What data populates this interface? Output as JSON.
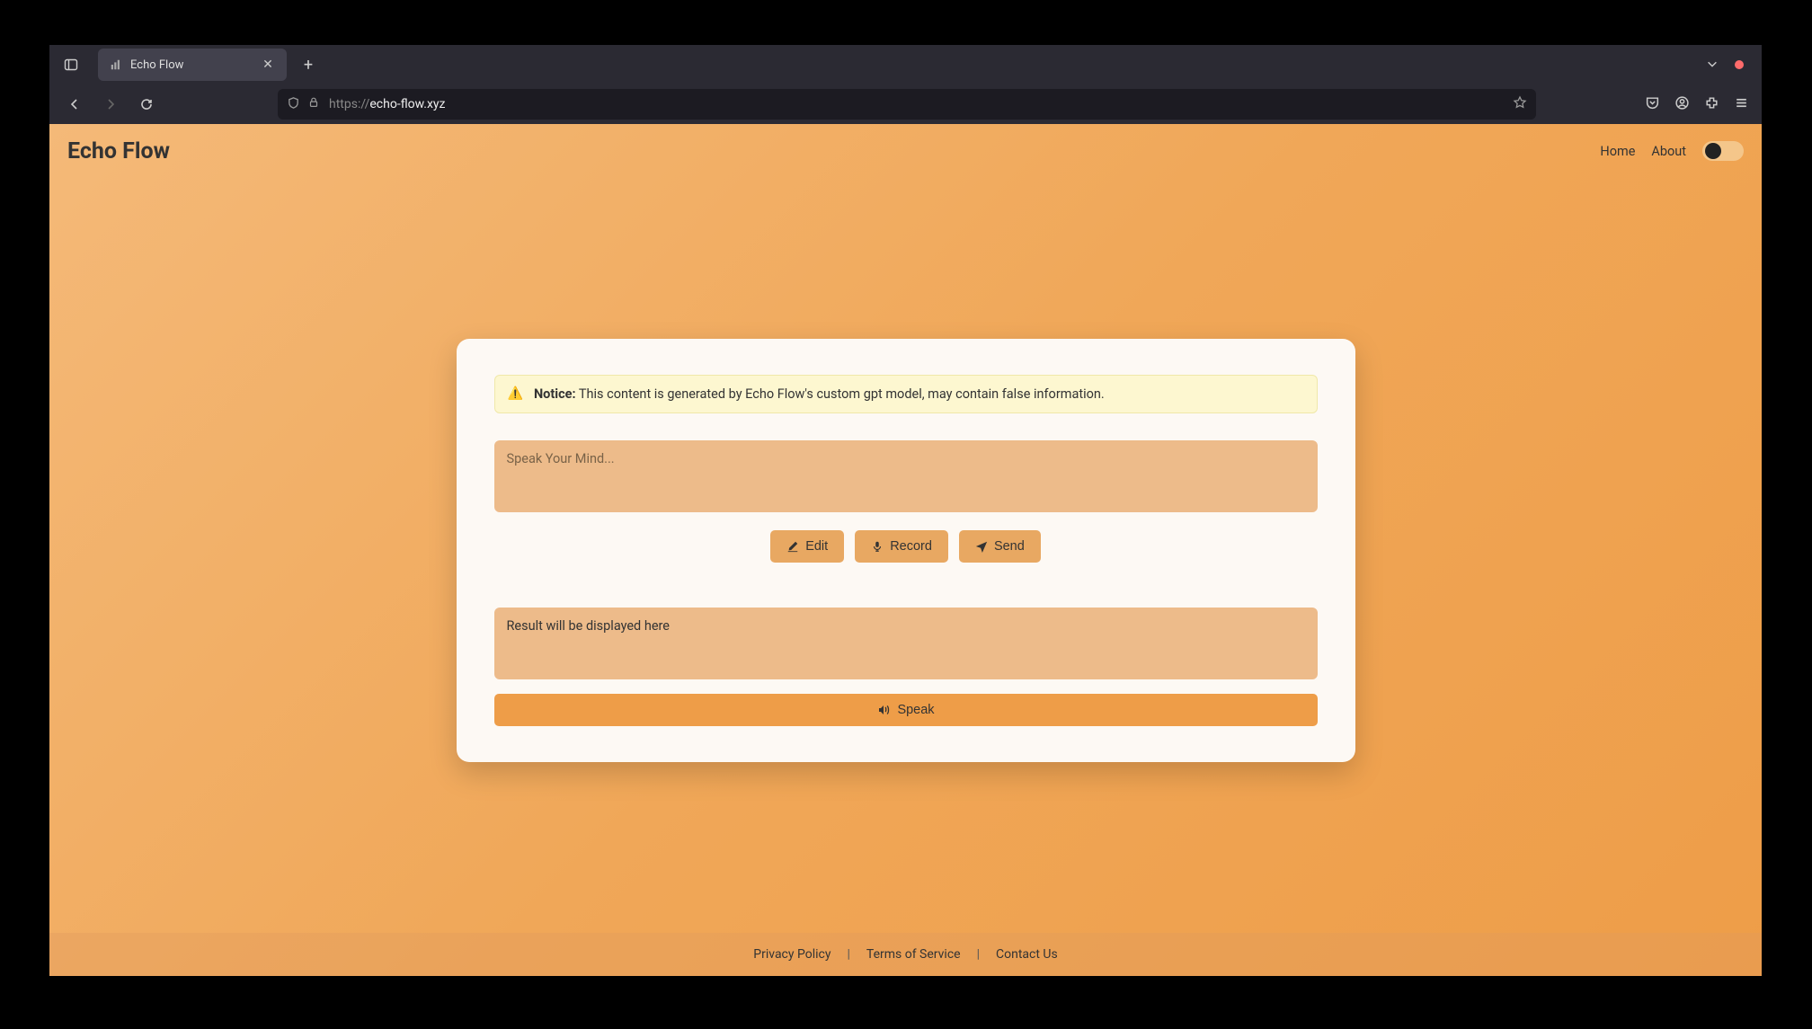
{
  "browser": {
    "tab_title": "Echo Flow",
    "url_prefix": "https://",
    "url_domain": "echo-flow.xyz"
  },
  "header": {
    "logo": "Echo Flow",
    "nav": {
      "home": "Home",
      "about": "About"
    }
  },
  "notice": {
    "icon": "⚠️",
    "label": "Notice:",
    "text": " This content is generated by Echo Flow's custom gpt model, may contain false information."
  },
  "input": {
    "placeholder": "Speak Your Mind..."
  },
  "buttons": {
    "edit": "Edit",
    "record": "Record",
    "send": "Send",
    "speak": "Speak"
  },
  "result": {
    "placeholder": "Result will be displayed here"
  },
  "footer": {
    "privacy": "Privacy Policy",
    "terms": "Terms of Service",
    "contact": "Contact Us"
  }
}
